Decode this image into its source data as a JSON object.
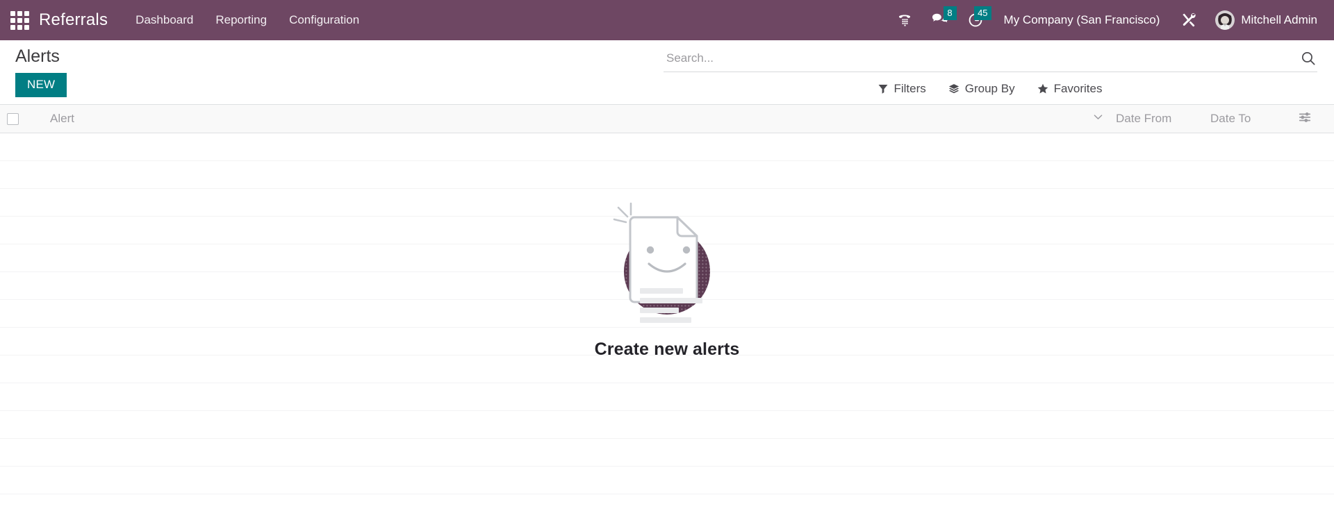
{
  "navbar": {
    "apps_icon": "apps-grid-icon",
    "brand": "Referrals",
    "menu": [
      {
        "label": "Dashboard"
      },
      {
        "label": "Reporting"
      },
      {
        "label": "Configuration"
      }
    ],
    "systray": [
      {
        "name": "voip-dialpad-icon",
        "icon": "phone-dialpad-icon",
        "badge": null
      },
      {
        "name": "messages-icon",
        "icon": "chat-bubbles-icon",
        "badge": "8"
      },
      {
        "name": "activities-icon",
        "icon": "clock-icon",
        "badge": "45"
      }
    ],
    "company": "My Company (San Francisco)",
    "debug_icon": "wrench-screwdriver-icon",
    "user": "Mitchell Admin"
  },
  "control_panel": {
    "title": "Alerts",
    "new_label": "NEW",
    "search": {
      "placeholder": "Search...",
      "value": "",
      "icon": "search-icon"
    },
    "filters": [
      {
        "label": "Filters",
        "icon": "filter-funnel-icon"
      },
      {
        "label": "Group By",
        "icon": "layers-icon"
      },
      {
        "label": "Favorites",
        "icon": "star-icon"
      }
    ]
  },
  "list": {
    "columns": [
      {
        "key": "select",
        "label": ""
      },
      {
        "key": "alert",
        "label": "Alert"
      },
      {
        "key": "date_from",
        "label": "Date From"
      },
      {
        "key": "date_to",
        "label": "Date To"
      }
    ],
    "rows": [],
    "empty_row_count": 13,
    "chevron_icon": "chevron-down-icon",
    "optional_columns_icon": "column-settings-icon"
  },
  "empty_state": {
    "title": "Create new alerts",
    "illustration": "smiling-document-icon"
  },
  "colors": {
    "navbar_bg": "#6E4763",
    "accent_teal": "#017E84",
    "badge_bg": "#017E84",
    "illustration_circle": "#5C3A52",
    "text_primary": "#3c3b3e",
    "text_muted": "#9c9ba0"
  }
}
